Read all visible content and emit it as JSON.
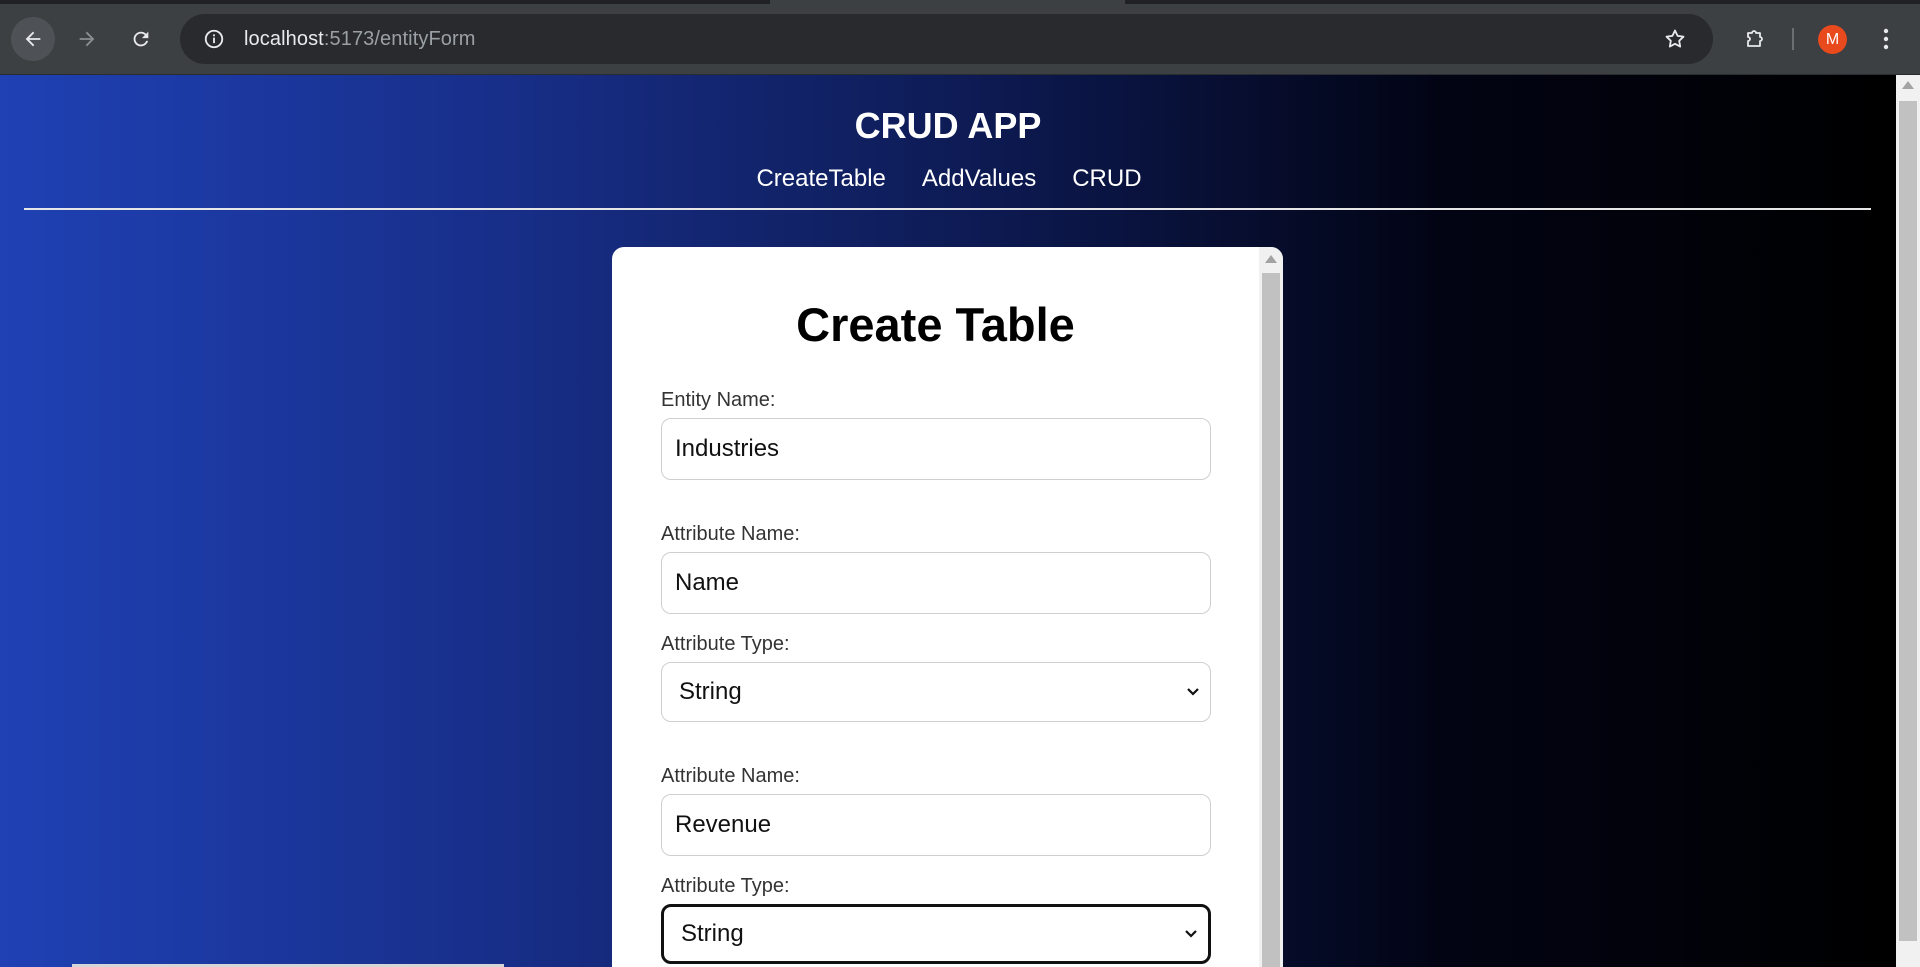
{
  "browser": {
    "url_host": "localhost",
    "url_path": ":5173/entityForm",
    "avatar_letter": "M",
    "icons": {
      "back": "arrow-left-icon",
      "forward": "arrow-right-icon",
      "reload": "reload-icon",
      "site_info": "info-icon",
      "bookmark": "star-icon",
      "extensions": "puzzle-icon",
      "menu": "kebab-menu-icon"
    }
  },
  "header": {
    "title": "CRUD APP",
    "nav": [
      "CreateTable",
      "AddValues",
      "CRUD"
    ]
  },
  "form": {
    "title": "Create Table",
    "entity_label": "Entity Name:",
    "entity_value": "Industries",
    "attributes": [
      {
        "name_label": "Attribute Name:",
        "name_value": "Name",
        "type_label": "Attribute Type:",
        "type_value": "String"
      },
      {
        "name_label": "Attribute Name:",
        "name_value": "Revenue",
        "type_label": "Attribute Type:",
        "type_value": "String"
      }
    ]
  },
  "colors": {
    "gradient_start": "#1f41b4",
    "gradient_end": "#000000",
    "chrome_bg": "#3c4043",
    "avatar_bg": "#e8491d"
  }
}
